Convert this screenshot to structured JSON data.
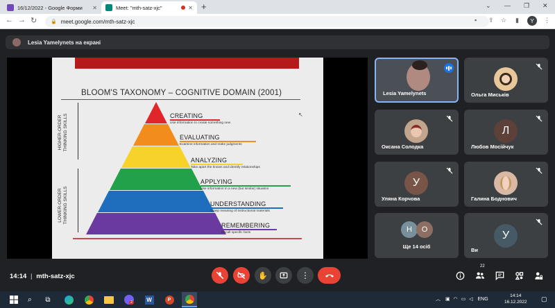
{
  "browser": {
    "tabs": [
      {
        "title": "16/12/2022 - Google Форми",
        "active": false
      },
      {
        "title": "Meet: \"mth-satz-xjc\"",
        "active": true
      }
    ],
    "url": "meet.google.com/mth-satz-xjc",
    "profile_initial": "Y"
  },
  "meet": {
    "presenting_label": "Lesia Yamelynets на екрані",
    "time": "14:14",
    "meeting_code": "mth-satz-xjc",
    "participant_count": "22"
  },
  "slide": {
    "title": "BLOOM'S TAXONOMY – COGNITIVE DOMAIN (2001)",
    "higher_order_label": [
      "HIGHER-ORDER",
      "THINKING SKILLS"
    ],
    "lower_order_label": [
      "LOWER-ORDER",
      "THINKING SKILLS"
    ],
    "levels": [
      {
        "name": "CREATING",
        "description": "Use information to create something new",
        "color": "#e0262b"
      },
      {
        "name": "EVALUATING",
        "description": "Examine information and make judgments",
        "color": "#f28c1c"
      },
      {
        "name": "ANALYZING",
        "description": "Take apart the known and identify relationships",
        "color": "#f6d22a"
      },
      {
        "name": "APPLYING",
        "description": "Use information in a new (but similar) situation",
        "color": "#22a04a"
      },
      {
        "name": "UNDERSTANDING",
        "description": "Grasp meaning of instructional materials",
        "color": "#1e6ebd"
      },
      {
        "name": "REMEMBERING",
        "description": "Recall specific facts",
        "color": "#6a3aa0"
      }
    ]
  },
  "participants": [
    {
      "name": "Lesia Yamelynets",
      "type": "video",
      "speaking": true
    },
    {
      "name": "Ольга Миськів",
      "type": "photo",
      "muted": true
    },
    {
      "name": "Оксана Солодка",
      "type": "photo",
      "muted": true
    },
    {
      "name": "Любов Мосійчук",
      "type": "initial",
      "initial": "Л",
      "color": "#5d4037",
      "muted": true
    },
    {
      "name": "Уляна Корчова",
      "type": "initial",
      "initial": "У",
      "color": "#795548",
      "muted": true
    },
    {
      "name": "Галина Боднович",
      "type": "photo",
      "muted": true
    },
    {
      "name": "Ще 14 осіб",
      "type": "group",
      "initials": [
        "Н",
        "О"
      ],
      "colors": [
        "#78909c",
        "#8d6e63"
      ]
    },
    {
      "name": "Ви",
      "type": "initial",
      "initial": "У",
      "color": "#455a64",
      "muted": true
    }
  ],
  "taskbar": {
    "tray": "ENG",
    "clock_time": "14:14",
    "clock_date": "16.12.2022",
    "badge_count": "2"
  },
  "colors": {
    "meet_bg": "#202124",
    "tile_bg": "#3c4043",
    "red": "#ea4335",
    "speaking_border": "#8ab4f8"
  }
}
